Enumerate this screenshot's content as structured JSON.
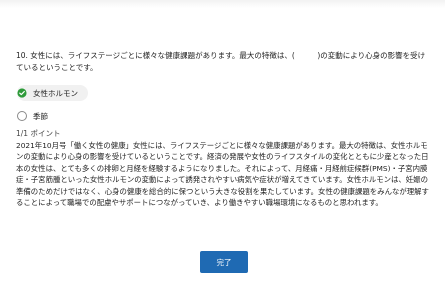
{
  "question": {
    "text": "10. 女性には、ライフステージごとに様々な健康課題があります。最大の特徴は、(　　　)の変動により心身の影響を受けているということです。"
  },
  "options": [
    {
      "label": "女性ホルモン",
      "selected": true
    },
    {
      "label": "季節",
      "selected": false
    }
  ],
  "points": "1/1 ポイント",
  "explanation": "2021年10月号「働く女性の健康」女性には、ライフステージごとに様々な健康課題があります。最大の特徴は、女性ホルモンの変動により心身の影響を受けているということです。経済の発展や女性のライフスタイルの変化とともに少産となった日本の女性は、とても多くの排卵と月経を経験するようになりました。それによって、月経痛・月経前症候群(PMS)・子宮内膜症・子宮筋腫といった女性ホルモンの変動によって誘発されやすい病気や症状が増えてきています。女性ホルモンは、妊娠の準備のためだけではなく、心身の健康を総合的に保つという大きな役割を果たしています。女性の健康課題をみんなが理解することによって職場での配慮やサポートにつながっていき、より働きやすい職場環境になるものと思われます。",
  "done_label": "完了",
  "colors": {
    "accent": "#1f6ab3",
    "correct": "#2e9a3a"
  }
}
